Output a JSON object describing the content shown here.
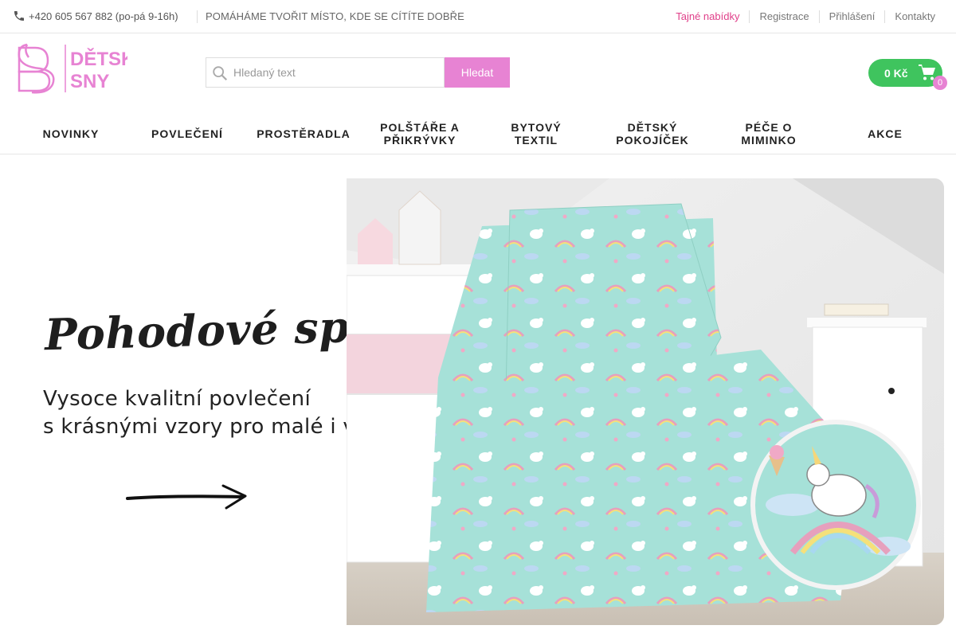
{
  "topbar": {
    "phone": "+420 605 567 882 (po-pá 9-16h)",
    "tagline": "POMÁHÁME TVOŘIT MÍSTO, KDE SE CÍTÍTE DOBŘE",
    "links": [
      "Tajné nabídky",
      "Registrace",
      "Přihlášení",
      "Kontakty"
    ]
  },
  "logo": {
    "line1": "DĚTSKÉ",
    "line2": "SNY",
    "color": "#e783d3"
  },
  "search": {
    "placeholder": "Hledaný text",
    "button": "Hledat"
  },
  "cart": {
    "total": "0 Kč",
    "count": "0",
    "color": "#3fc45e"
  },
  "nav": [
    "NOVINKY",
    "POVLEČENÍ",
    "PROSTĚRADLA",
    "POLŠTÁŘE A PŘIKRÝVKY",
    "BYTOVÝ TEXTIL",
    "DĚTSKÝ POKOJÍČEK",
    "PÉČE O MIMINKO",
    "AKCE"
  ],
  "hero": {
    "headline": "Pohodové spaní",
    "line1": "Vysoce kvalitní povlečení",
    "line2": "s krásnými vzory pro malé i velké"
  },
  "colors": {
    "accent": "#e783d3",
    "secret": "#e0408a",
    "cart": "#3fc45e",
    "bedding": "#a6e1d8"
  }
}
